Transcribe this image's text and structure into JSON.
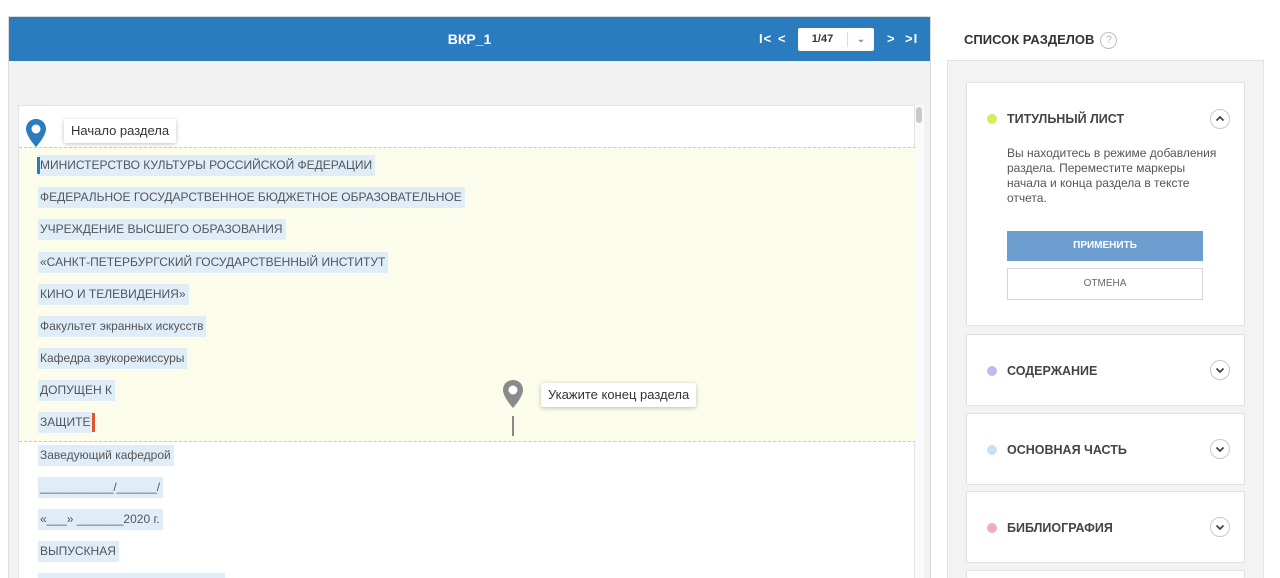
{
  "viewer": {
    "title": "ВКР_1",
    "nav_first": "I<",
    "nav_prev": "<",
    "nav_next": ">",
    "nav_last": ">I",
    "page_indicator": "1/47",
    "page_dropdown": "⌄"
  },
  "markers": {
    "start_label": "Начало раздела",
    "end_label": "Укажите конец раздела"
  },
  "document": {
    "lines": [
      "МИНИСТЕРСТВО КУЛЬТУРЫ РОССИЙСКОЙ ФЕДЕРАЦИИ",
      "ФЕДЕРАЛЬНОЕ ГОСУДАРСТВЕННОЕ БЮДЖЕТНОЕ ОБРАЗОВАТЕЛЬНОЕ",
      "УЧРЕЖДЕНИЕ ВЫСШЕГО ОБРАЗОВАНИЯ",
      "«САНКТ-ПЕТЕРБУРГСКИЙ ГОСУДАРСТВЕННЫЙ ИНСТИТУТ",
      "КИНО И ТЕЛЕВИДЕНИЯ»",
      "Факультет экранных искусств",
      "Кафедра звукорежиссуры",
      "ДОПУЩЕН К",
      "ЗАЩИТЕ",
      "Заведующий кафедрой",
      "___________/______/",
      "«___» _______2020 г.",
      "ВЫПУСКНАЯ"
    ]
  },
  "panel": {
    "title": "СПИСОК РАЗДЕЛОВ",
    "help_icon": "?",
    "sections": [
      {
        "name": "ТИТУЛЬНЫЙ ЛИСТ",
        "color": "#d9ea5a",
        "expanded": true
      },
      {
        "name": "СОДЕРЖАНИЕ",
        "color": "#c7b6ef",
        "expanded": false
      },
      {
        "name": "ОСНОВНАЯ ЧАСТЬ",
        "color": "#c4e1f5",
        "expanded": false
      },
      {
        "name": "БИБЛИОГРАФИЯ",
        "color": "#eeadbf",
        "expanded": false
      }
    ],
    "info_text": "Вы находитесь в режиме добавления раздела. Переместите маркеры начала и конца раздела в тексте отчета.",
    "apply_label": "ПРИМЕНИТЬ",
    "cancel_label": "ОТМЕНА"
  },
  "colors": {
    "header_blue": "#2b7bbf",
    "apply_button": "#6c9fcf",
    "start_marker": "#2b7bbf",
    "end_marker": "#8a8a8a",
    "end_cursor": "#e0552d",
    "section_highlight": "#fbfce9",
    "text_highlight": "#dfedf8"
  }
}
